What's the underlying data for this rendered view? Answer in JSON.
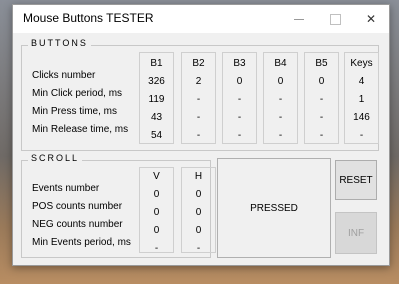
{
  "window": {
    "title": "Mouse Buttons TESTER"
  },
  "titlebar_controls": {
    "minimize": "—",
    "maximize": "□",
    "close": "✕"
  },
  "buttons_group": {
    "title": "BUTTONS",
    "row_labels": [
      "Clicks number",
      "Min Click period, ms",
      "Min Press time, ms",
      "Min Release time, ms"
    ],
    "columns": [
      {
        "header": "B1",
        "values": [
          "326",
          "119",
          "43",
          "54"
        ]
      },
      {
        "header": "B2",
        "values": [
          "2",
          "-",
          "-",
          "-"
        ]
      },
      {
        "header": "B3",
        "values": [
          "0",
          "-",
          "-",
          "-"
        ]
      },
      {
        "header": "B4",
        "values": [
          "0",
          "-",
          "-",
          "-"
        ]
      },
      {
        "header": "B5",
        "values": [
          "0",
          "-",
          "-",
          "-"
        ]
      },
      {
        "header": "Keys",
        "values": [
          "4",
          "1",
          "146",
          "-"
        ]
      }
    ]
  },
  "scroll_group": {
    "title": "SCROLL",
    "row_labels": [
      "Events number",
      "POS counts number",
      "NEG counts number",
      "Min Events period, ms"
    ],
    "columns": [
      {
        "header": "V",
        "values": [
          "0",
          "0",
          "0",
          "-"
        ]
      },
      {
        "header": "H",
        "values": [
          "0",
          "0",
          "0",
          "-"
        ]
      }
    ]
  },
  "status": {
    "text": "PRESSED"
  },
  "actions": {
    "reset_label": "RESET",
    "inf_label": "INF"
  },
  "colors": {
    "window_bg": "#f0f0f0",
    "titlebar_bg": "#ffffff",
    "disabled_text": "#a0a0a0"
  }
}
